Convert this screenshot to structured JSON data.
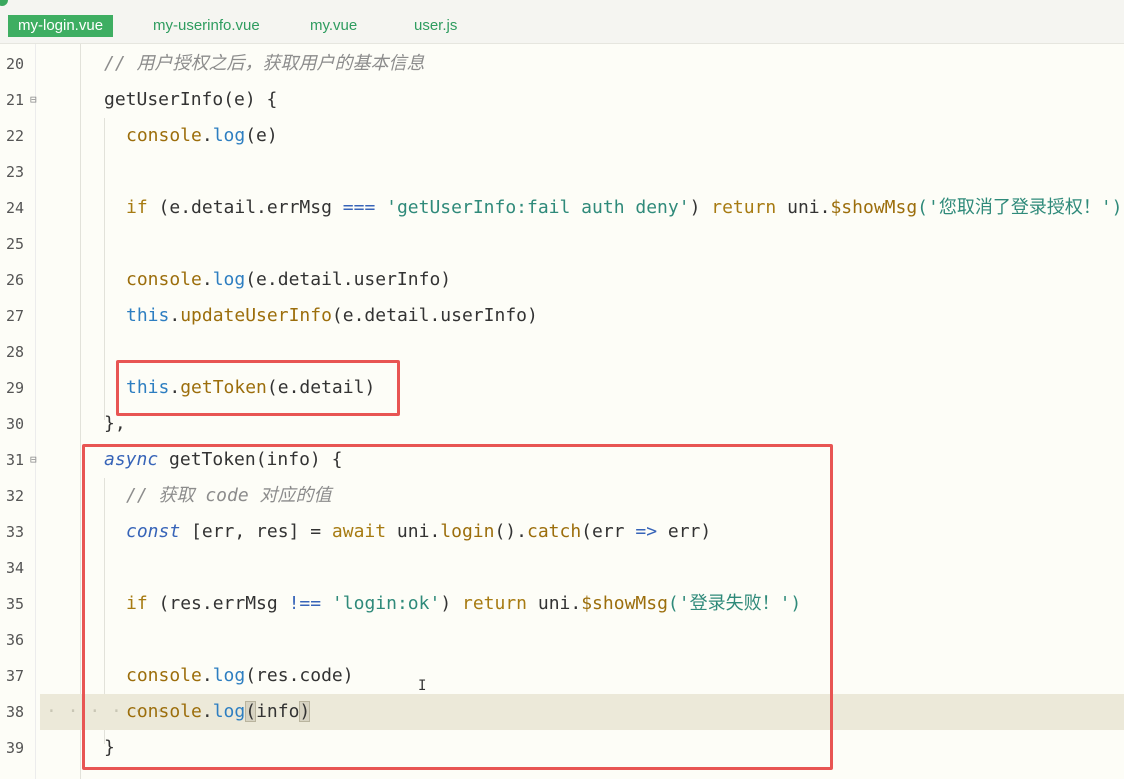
{
  "tabs": [
    {
      "label": "my-login.vue",
      "active": true
    },
    {
      "label": "my-userinfo.vue",
      "active": false
    },
    {
      "label": "my.vue",
      "active": false
    },
    {
      "label": "user.js",
      "active": false
    }
  ],
  "lines": {
    "n20": "20",
    "n21": "21",
    "n22": "22",
    "n23": "23",
    "n24": "24",
    "n25": "25",
    "n26": "26",
    "n27": "27",
    "n28": "28",
    "n29": "29",
    "n30": "30",
    "n31": "31",
    "n32": "32",
    "n33": "33",
    "n34": "34",
    "n35": "35",
    "n36": "36",
    "n37": "37",
    "n38": "38",
    "n39": "39"
  },
  "code": {
    "l20_comment": "// 用户授权之后，获取用户的基本信息",
    "l21_fn": "getUserInfo(e) {",
    "l22_console": "console",
    "l22_log": "log",
    "l22_args": "(e)",
    "l24_if": "if",
    "l24_cond": " (e.detail.errMsg ",
    "l24_op": "===",
    "l24_str": " 'getUserInfo:fail auth deny'",
    "l24_close": ") ",
    "l24_return": "return",
    "l24_uni": " uni.",
    "l24_show": "$showMsg",
    "l24_arg": "('您取消了登录授权！')",
    "l26_console": "console",
    "l26_log": "log",
    "l26_args": "(e.detail.userInfo)",
    "l27_this": "this",
    "l27_fn": "updateUserInfo",
    "l27_args": "(e.detail.userInfo)",
    "l29_this": "this",
    "l29_fn": "getToken",
    "l29_args": "(e.detail)",
    "l30_close": "},",
    "l31_async": "async",
    "l31_fn": " getToken(info) {",
    "l32_comment": "// 获取 code 对应的值",
    "l33_const": "const",
    "l33_vars": " [err, res] = ",
    "l33_await": "await",
    "l33_uni": " uni.",
    "l33_login": "login",
    "l33_mid": "().",
    "l33_catch": "catch",
    "l33_args": "(err ",
    "l33_arrow": "=>",
    "l33_end": " err)",
    "l35_if": "if",
    "l35_cond": " (res.errMsg ",
    "l35_op": "!==",
    "l35_str": " 'login:ok'",
    "l35_close": ") ",
    "l35_return": "return",
    "l35_uni": " uni.",
    "l35_show": "$showMsg",
    "l35_arg": "('登录失败！')",
    "l37_console": "console",
    "l37_log": "log",
    "l37_args": "(res.code)",
    "l38_dots": "· · · · · ·",
    "l38_console": "console",
    "l38_log": "log",
    "l38_open": "(",
    "l38_info": "info",
    "l38_close": ")",
    "l39_close": "}"
  },
  "colors": {
    "highlight_box": "#e85553",
    "active_tab": "#3eae62"
  }
}
